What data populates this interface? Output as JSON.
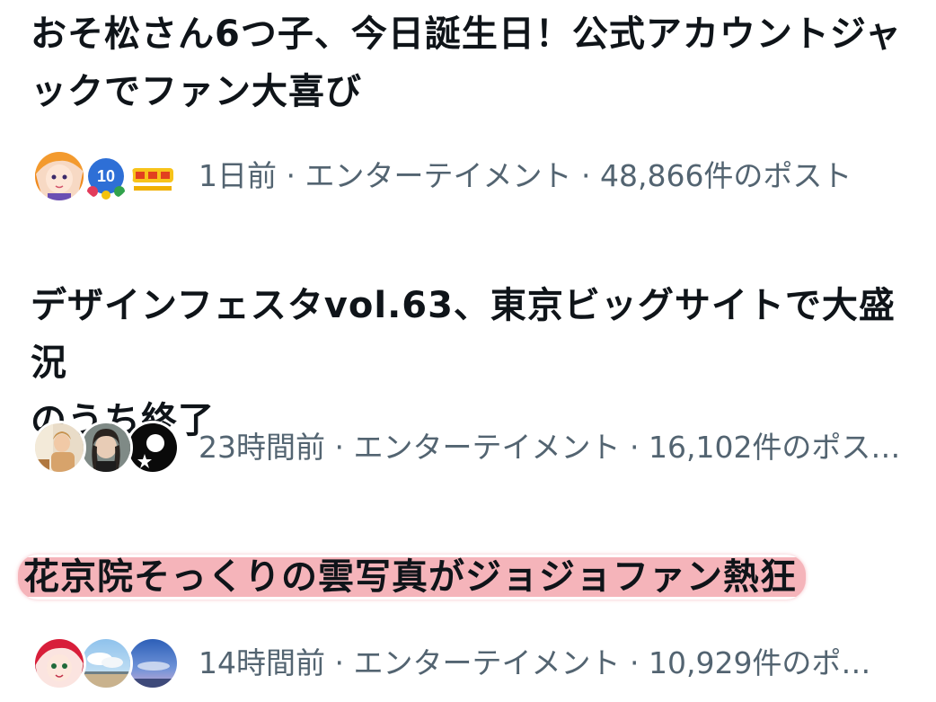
{
  "trends": [
    {
      "title_line1": "おそ松さん6つ子、今日誕生日！公式アカウントジャ",
      "title_line2": "ックでファン大喜び",
      "time": "1日前",
      "sep1": " · ",
      "category": "エンターテイメント",
      "sep2": " · ",
      "posts": "48,866件のポスト",
      "avatars": [
        "orange-haired-character-avatar",
        "anime-logo-10th-avatar",
        "yellow-logo-avatar"
      ]
    },
    {
      "title_line1": "デザインフェスタvol.63、東京ビッグサイトで大盛況",
      "title_line2": "のうち終了",
      "time": "23時間前",
      "sep1": " · ",
      "category": "エンターテイメント",
      "sep2": " · ",
      "posts": "16,102件のポス…",
      "avatars": [
        "photo-person-avatar",
        "dark-haired-person-avatar",
        "black-white-star-avatar"
      ]
    },
    {
      "title_line1": "花京院そっくりの雲写真がジョジョファン熱狂",
      "time": "14時間前",
      "sep1": " · ",
      "category": "エンターテイメント",
      "sep2": " · ",
      "posts": "10,929件のポ…",
      "avatars": [
        "red-haired-character-avatar",
        "cloud-landscape-avatar",
        "blue-sky-avatar"
      ],
      "highlight_color": "#f4acb2"
    }
  ]
}
